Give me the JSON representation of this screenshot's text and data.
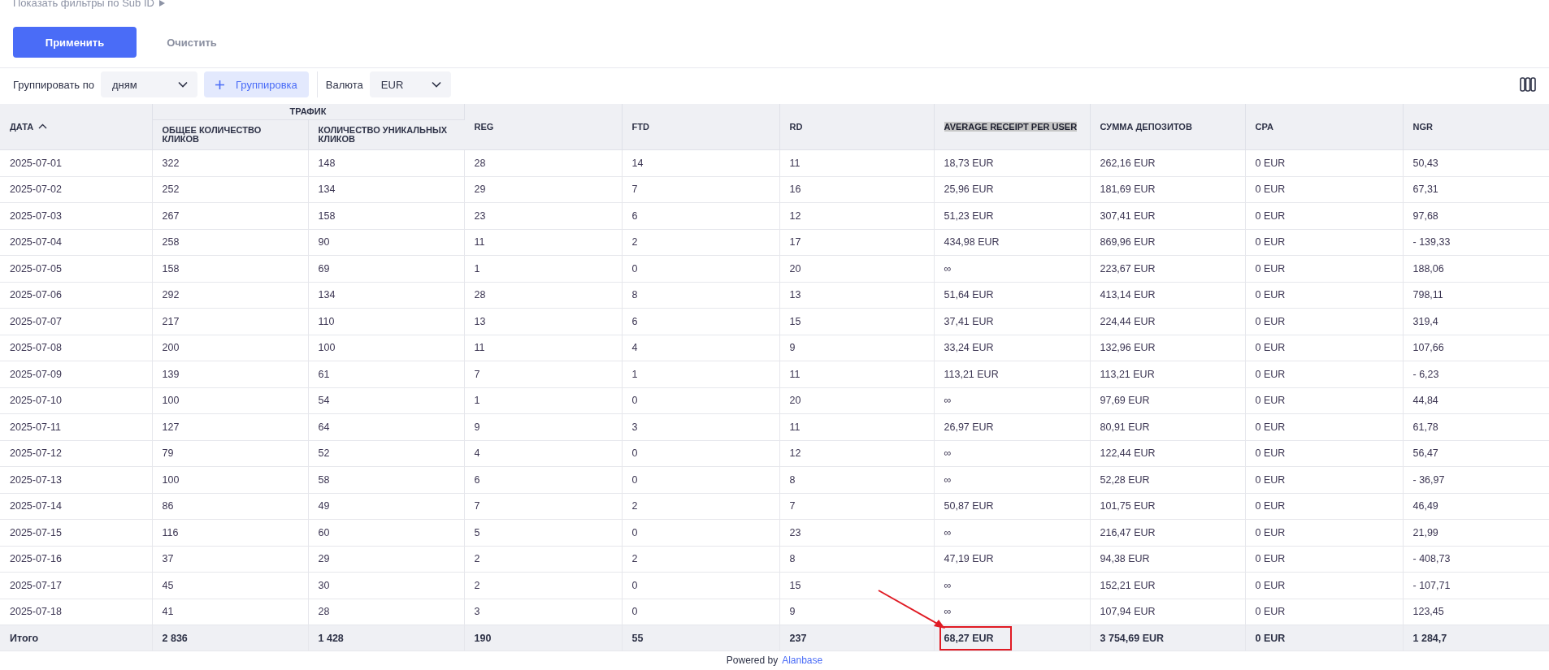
{
  "filters_link": {
    "label": "Показать фильтры по Sub ID"
  },
  "actions": [
    {
      "label": "Применить",
      "kind": "primary"
    },
    {
      "label": "Очистить",
      "kind": "secondary"
    }
  ],
  "toolbar": {
    "group_by_label": "Группировать по",
    "group_by_value": "дням",
    "add_group_button": "Группировка",
    "currency_label": "Валюта",
    "currency_value": "EUR"
  },
  "table": {
    "group_header": {
      "label": "ТРАФИК"
    },
    "columns": [
      {
        "label": "ДАТА",
        "kind": "single",
        "sorted": true,
        "text_selected": false
      },
      {
        "label": "ОБЩЕЕ КОЛИЧЕСТВО КЛИКОВ",
        "kind": "grouped",
        "text_selected": false
      },
      {
        "label": "КОЛИЧЕСТВО УНИКАЛЬНЫХ КЛИКОВ",
        "kind": "grouped",
        "text_selected": false
      },
      {
        "label": "REG",
        "kind": "single",
        "sorted": false,
        "text_selected": false
      },
      {
        "label": "FTD",
        "kind": "single",
        "sorted": false,
        "text_selected": false
      },
      {
        "label": "RD",
        "kind": "single",
        "sorted": false,
        "text_selected": false
      },
      {
        "label": "AVERAGE RECEIPT PER USER",
        "kind": "single",
        "sorted": false,
        "text_selected": true
      },
      {
        "label": "СУММА ДЕПОЗИТОВ",
        "kind": "single",
        "sorted": false,
        "text_selected": false
      },
      {
        "label": "CPA",
        "kind": "single",
        "sorted": false,
        "text_selected": false
      },
      {
        "label": "NGR",
        "kind": "single",
        "sorted": false,
        "text_selected": false
      }
    ],
    "rows": [
      [
        "2025-07-01",
        "322",
        "148",
        "28",
        "14",
        "11",
        "18,73 EUR",
        "262,16 EUR",
        "0 EUR",
        "50,43"
      ],
      [
        "2025-07-02",
        "252",
        "134",
        "29",
        "7",
        "16",
        "25,96 EUR",
        "181,69 EUR",
        "0 EUR",
        "67,31"
      ],
      [
        "2025-07-03",
        "267",
        "158",
        "23",
        "6",
        "12",
        "51,23 EUR",
        "307,41 EUR",
        "0 EUR",
        "97,68"
      ],
      [
        "2025-07-04",
        "258",
        "90",
        "11",
        "2",
        "17",
        "434,98 EUR",
        "869,96 EUR",
        "0 EUR",
        "- 139,33"
      ],
      [
        "2025-07-05",
        "158",
        "69",
        "1",
        "0",
        "20",
        "∞",
        "223,67 EUR",
        "0 EUR",
        "188,06"
      ],
      [
        "2025-07-06",
        "292",
        "134",
        "28",
        "8",
        "13",
        "51,64 EUR",
        "413,14 EUR",
        "0 EUR",
        "798,11"
      ],
      [
        "2025-07-07",
        "217",
        "110",
        "13",
        "6",
        "15",
        "37,41 EUR",
        "224,44 EUR",
        "0 EUR",
        "319,4"
      ],
      [
        "2025-07-08",
        "200",
        "100",
        "11",
        "4",
        "9",
        "33,24 EUR",
        "132,96 EUR",
        "0 EUR",
        "107,66"
      ],
      [
        "2025-07-09",
        "139",
        "61",
        "7",
        "1",
        "11",
        "113,21 EUR",
        "113,21 EUR",
        "0 EUR",
        "- 6,23"
      ],
      [
        "2025-07-10",
        "100",
        "54",
        "1",
        "0",
        "20",
        "∞",
        "97,69 EUR",
        "0 EUR",
        "44,84"
      ],
      [
        "2025-07-11",
        "127",
        "64",
        "9",
        "3",
        "11",
        "26,97 EUR",
        "80,91 EUR",
        "0 EUR",
        "61,78"
      ],
      [
        "2025-07-12",
        "79",
        "52",
        "4",
        "0",
        "12",
        "∞",
        "122,44 EUR",
        "0 EUR",
        "56,47"
      ],
      [
        "2025-07-13",
        "100",
        "58",
        "6",
        "0",
        "8",
        "∞",
        "52,28 EUR",
        "0 EUR",
        "- 36,97"
      ],
      [
        "2025-07-14",
        "86",
        "49",
        "7",
        "2",
        "7",
        "50,87 EUR",
        "101,75 EUR",
        "0 EUR",
        "46,49"
      ],
      [
        "2025-07-15",
        "116",
        "60",
        "5",
        "0",
        "23",
        "∞",
        "216,47 EUR",
        "0 EUR",
        "21,99"
      ],
      [
        "2025-07-16",
        "37",
        "29",
        "2",
        "2",
        "8",
        "47,19 EUR",
        "94,38 EUR",
        "0 EUR",
        "- 408,73"
      ],
      [
        "2025-07-17",
        "45",
        "30",
        "2",
        "0",
        "15",
        "∞",
        "152,21 EUR",
        "0 EUR",
        "- 107,71"
      ],
      [
        "2025-07-18",
        "41",
        "28",
        "3",
        "0",
        "9",
        "∞",
        "107,94 EUR",
        "0 EUR",
        "123,45"
      ]
    ],
    "total": {
      "label": "Итого",
      "cells": [
        {
          "text": "2 836",
          "highlighted": false
        },
        {
          "text": "1 428",
          "highlighted": false
        },
        {
          "text": "190",
          "highlighted": false
        },
        {
          "text": "55",
          "highlighted": false
        },
        {
          "text": "237",
          "highlighted": false
        },
        {
          "text": "68,27 EUR",
          "highlighted": true
        },
        {
          "text": "3 754,69 EUR",
          "highlighted": false
        },
        {
          "text": "0 EUR",
          "highlighted": false
        },
        {
          "text": "1 284,7",
          "highlighted": false
        }
      ]
    }
  },
  "footer": {
    "prefix": "Powered by",
    "link": "Alanbase"
  }
}
